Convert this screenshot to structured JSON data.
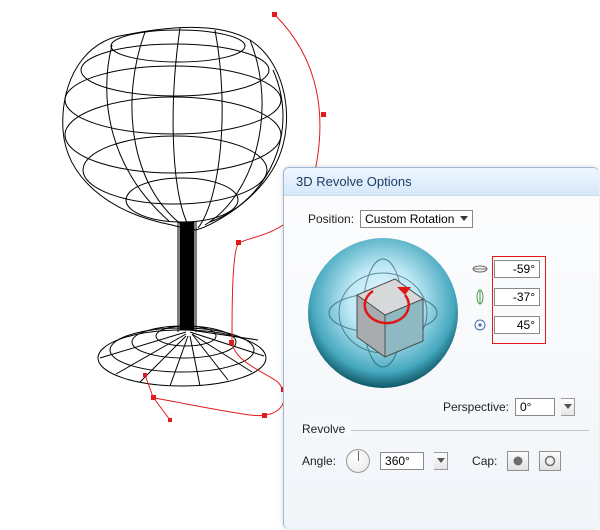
{
  "dialog": {
    "title": "3D Revolve Options",
    "position_label": "Position:",
    "position_value": "Custom Rotation",
    "rotation": {
      "x": "-59°",
      "y": "-37°",
      "z": "45°"
    },
    "perspective_label": "Perspective:",
    "perspective_value": "0°",
    "revolve": {
      "section_title": "Revolve",
      "angle_label": "Angle:",
      "angle_value": "360°",
      "cap_label": "Cap:"
    }
  },
  "icons": {
    "rot_x": "rotate-x-icon",
    "rot_y": "rotate-y-icon",
    "rot_z": "rotate-z-icon",
    "caret": "caret-down-icon",
    "cap_on": "cap-closed-icon",
    "cap_off": "cap-open-icon"
  }
}
